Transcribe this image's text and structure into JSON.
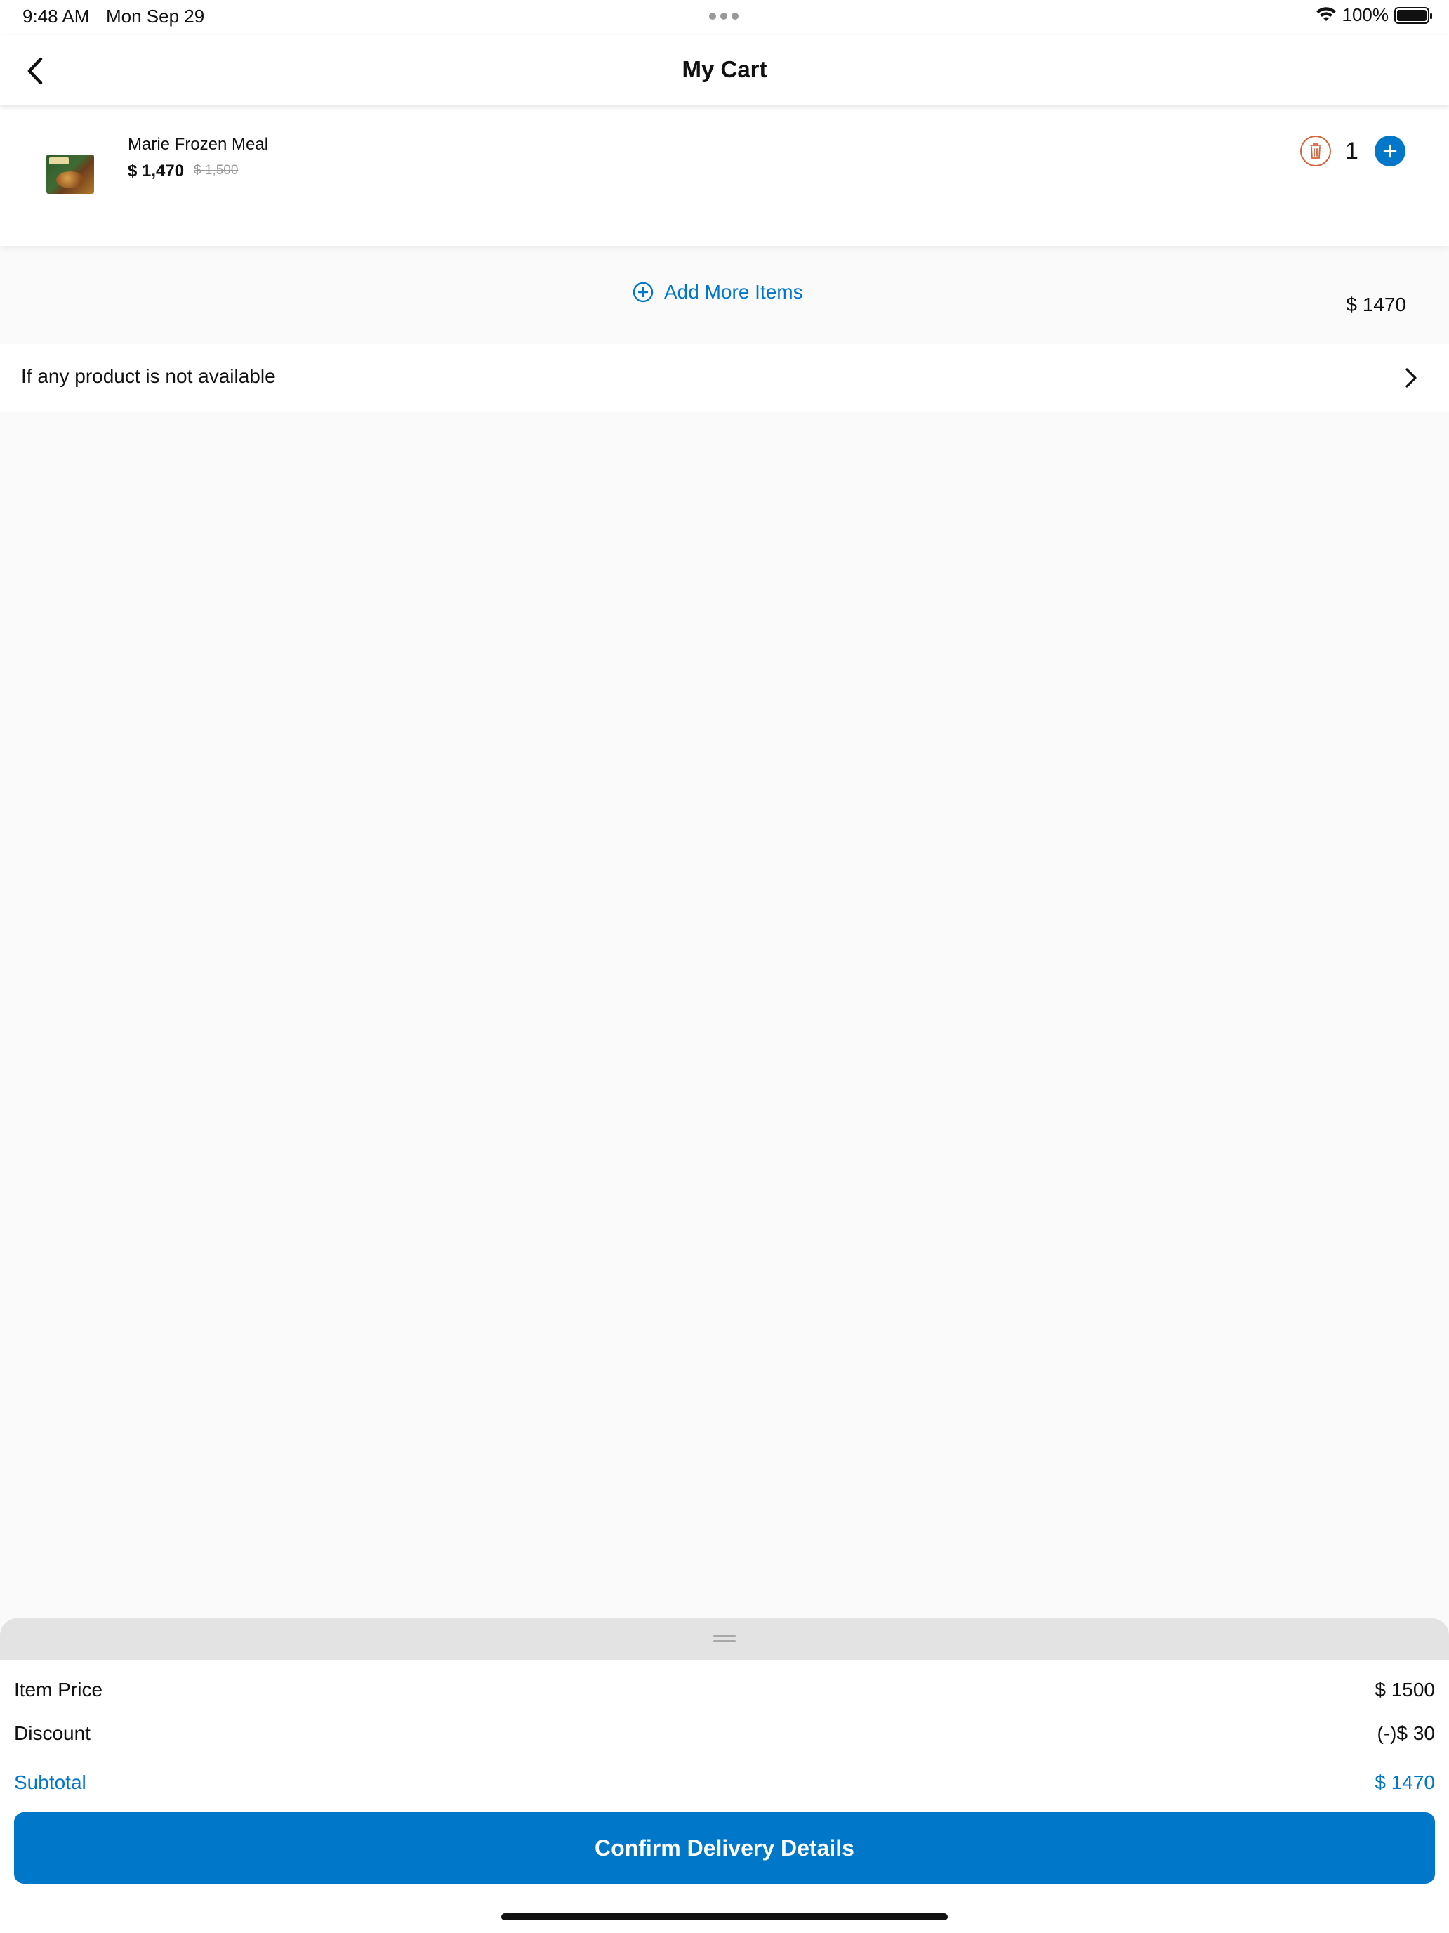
{
  "status_bar": {
    "time": "9:48 AM",
    "date": "Mon Sep 29",
    "battery": "100%",
    "icons": [
      "wifi-icon",
      "battery-icon"
    ]
  },
  "header": {
    "title": "My Cart",
    "back_icon": "chevron-left-icon"
  },
  "cart": {
    "items": [
      {
        "name": "Marie Frozen Meal",
        "price": "$ 1,470",
        "original_price": "$ 1,500",
        "quantity": "1",
        "line_total": "$ 1470"
      }
    ]
  },
  "actions": {
    "add_more_label": "Add More Items",
    "availability_label": "If any product is not available"
  },
  "summary": {
    "item_price_label": "Item Price",
    "item_price_value": "$ 1500",
    "discount_label": "Discount",
    "discount_value": "(-)$ 30",
    "subtotal_label": "Subtotal",
    "subtotal_value": "$ 1470",
    "confirm_label": "Confirm Delivery Details"
  },
  "colors": {
    "accent": "#0077c8",
    "delete": "#d2643c",
    "background": "#fafafa"
  }
}
